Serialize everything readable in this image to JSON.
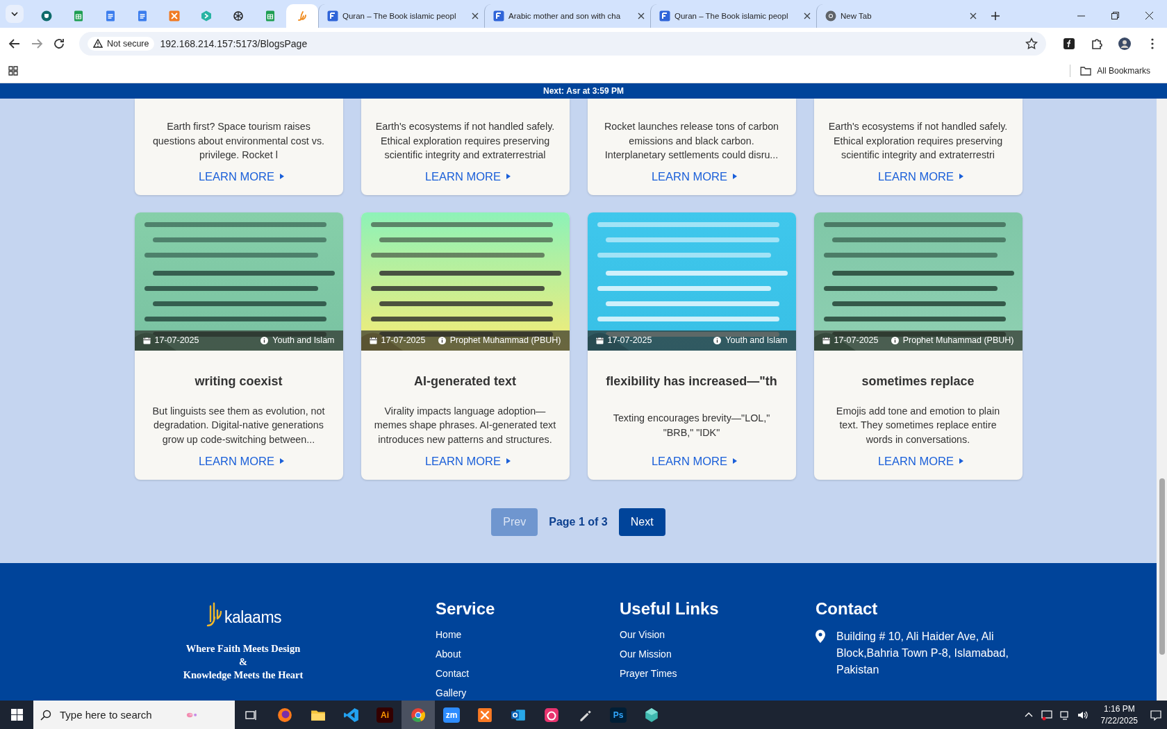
{
  "browser": {
    "tabs": [
      {
        "kind": "icon",
        "selected": false
      },
      {
        "kind": "icon",
        "selected": false
      },
      {
        "kind": "icon",
        "selected": false
      },
      {
        "kind": "icon",
        "selected": false
      },
      {
        "kind": "icon",
        "selected": false
      },
      {
        "kind": "icon",
        "selected": false
      },
      {
        "kind": "icon",
        "selected": false
      },
      {
        "kind": "icon",
        "selected": false
      },
      {
        "kind": "icon",
        "selected": true
      },
      {
        "kind": "page",
        "title": "Quran – The Book islamic peopl",
        "selected": false
      },
      {
        "kind": "page",
        "title": "Arabic mother and son with cha",
        "selected": false
      },
      {
        "kind": "page",
        "title": "Quran – The Book islamic peopl",
        "selected": false
      },
      {
        "kind": "newtab",
        "title": "New Tab",
        "selected": false
      }
    ],
    "security": "Not secure",
    "url": "192.168.214.157:5173/BlogsPage",
    "bookmarks_label": "All Bookmarks"
  },
  "banner": "Next: **Asr** at 3:59 PM",
  "top_cards": [
    {
      "description": "Earth first? Space tourism raises questions about environmental cost vs. privilege. Rocket l",
      "link": "LEARN MORE"
    },
    {
      "description": "Earth's ecosystems if not handled safely. Ethical exploration requires preserving scientific integrity and extraterrestrial",
      "link": "LEARN MORE"
    },
    {
      "description": "Rocket launches release tons of carbon emissions and black carbon. Interplanetary settlements could disru...",
      "link": "LEARN MORE"
    },
    {
      "description": "Earth's ecosystems if not handled safely. Ethical exploration requires preserving scientific integrity and extraterrestri",
      "link": "LEARN MORE"
    }
  ],
  "cards": [
    {
      "date": "17-07-2025",
      "category": "Youth and Islam",
      "title": "writing coexist",
      "description": "But linguists see them as evolution, not degradation. Digital-native generations grow up code-switching between...",
      "link": "LEARN MORE"
    },
    {
      "date": "17-07-2025",
      "category": "Prophet Muhammad (PBUH)",
      "title": "AI-generated text",
      "description": "Virality impacts language adoption—memes shape phrases. AI-generated text introduces new patterns and structures.",
      "link": "LEARN MORE"
    },
    {
      "date": "17-07-2025",
      "category": "Youth and Islam",
      "title": "flexibility has increased—\"th",
      "description": "Texting encourages brevity—\"LOL,\" \"BRB,\" \"IDK\"",
      "link": "LEARN MORE"
    },
    {
      "date": "17-07-2025",
      "category": "Prophet Muhammad (PBUH)",
      "title": "sometimes replace",
      "description": "Emojis add tone and emotion to plain text. They sometimes replace entire words in conversations.",
      "link": "LEARN MORE"
    }
  ],
  "pagination": {
    "prev": {
      "label": "Prev",
      "disabled": true
    },
    "page": "Page 1 of 3",
    "next": {
      "label": "Next",
      "disabled": false
    }
  },
  "footer": {
    "logo": "kalaams",
    "tagline": [
      "Where Faith Meets Design",
      "&",
      "Knowledge Meets the Heart"
    ],
    "columns": [
      {
        "title": "Service",
        "links": [
          "Home",
          "About",
          "Contact",
          "Gallery"
        ]
      },
      {
        "title": "Useful Links",
        "links": [
          "Our Vision",
          "Our Mission",
          "Prayer Times"
        ]
      }
    ],
    "contact": {
      "title": "Contact",
      "address": "Building # 10, Ali Haider Ave, Ali Block,Bahria Town P-8, Islamabad, Pakistan"
    }
  },
  "taskbar": {
    "search_placeholder": "Type here to search",
    "apps": [
      {
        "kind": "icon",
        "selected": false
      },
      {
        "kind": "icon",
        "selected": false
      },
      {
        "kind": "icon",
        "selected": false
      },
      {
        "kind": "label",
        "label": "Ai",
        "selected": false
      },
      {
        "kind": "icon",
        "selected": true
      },
      {
        "kind": "label",
        "label": "zm",
        "selected": false
      },
      {
        "kind": "icon",
        "selected": false
      },
      {
        "kind": "icon",
        "selected": false
      },
      {
        "kind": "icon",
        "selected": false
      },
      {
        "kind": "icon",
        "selected": false
      },
      {
        "kind": "label",
        "label": "Ps",
        "selected": false
      },
      {
        "kind": "icon",
        "selected": false
      }
    ],
    "time": "1:16 PM",
    "date": "7/22/2025"
  }
}
